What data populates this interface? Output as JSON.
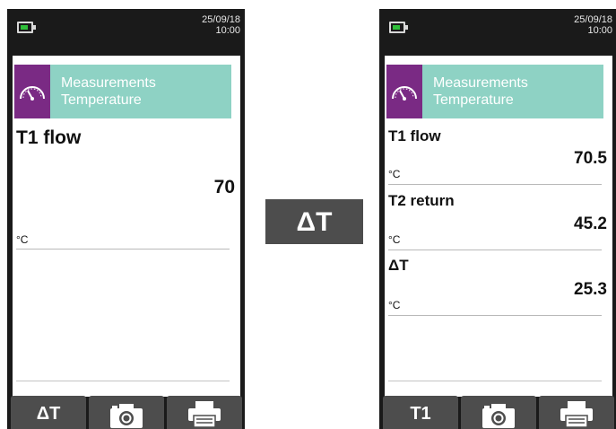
{
  "left": {
    "status": {
      "date": "25/09/18",
      "time": "10:00"
    },
    "header": {
      "line1": "Measurements",
      "line2": "Temperature"
    },
    "measurement": {
      "name": "T1 flow",
      "value": "70",
      "unit": "°C"
    },
    "softkeys": {
      "key1": "ΔT"
    }
  },
  "transition": {
    "label": "ΔT"
  },
  "right": {
    "status": {
      "date": "25/09/18",
      "time": "10:00"
    },
    "header": {
      "line1": "Measurements",
      "line2": "Temperature"
    },
    "measurements": [
      {
        "name": "T1 flow",
        "value": "70.5",
        "unit": "°C"
      },
      {
        "name": "T2 return",
        "value": "45.2",
        "unit": "°C"
      },
      {
        "name": "ΔT",
        "value": "25.3",
        "unit": "°C"
      }
    ],
    "softkeys": {
      "key1": "T1"
    }
  },
  "icons": {
    "battery": "battery-icon",
    "gauge": "gauge-icon",
    "camera": "camera-icon",
    "printer": "printer-icon"
  },
  "colors": {
    "device_body": "#1a1a1a",
    "header_bg": "#8ed2c4",
    "icon_bg": "#7a2a84",
    "softkey_bg": "#4d4d4d",
    "battery_level": "#2fbf3a"
  }
}
